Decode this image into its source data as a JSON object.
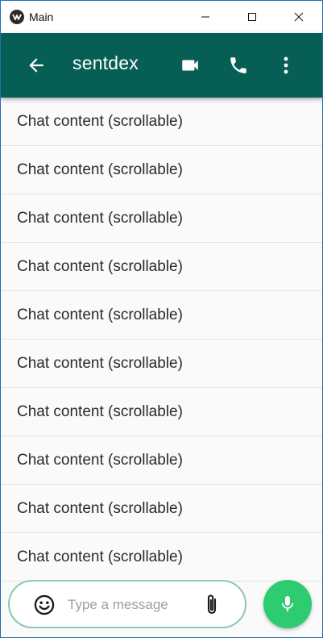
{
  "window": {
    "title": "Main",
    "controls": [
      "minimize",
      "maximize",
      "close"
    ]
  },
  "header": {
    "contact_name": "sentdex",
    "icons": [
      "back-arrow-icon",
      "videocam-icon",
      "phone-icon",
      "more-vert-icon"
    ],
    "background": "#075e54"
  },
  "chat": {
    "items": [
      {
        "text": "Chat content (scrollable)"
      },
      {
        "text": "Chat content (scrollable)"
      },
      {
        "text": "Chat content (scrollable)"
      },
      {
        "text": "Chat content (scrollable)"
      },
      {
        "text": "Chat content (scrollable)"
      },
      {
        "text": "Chat content (scrollable)"
      },
      {
        "text": "Chat content (scrollable)"
      },
      {
        "text": "Chat content (scrollable)"
      },
      {
        "text": "Chat content (scrollable)"
      },
      {
        "text": "Chat content (scrollable)"
      }
    ]
  },
  "composer": {
    "placeholder": "Type a message",
    "value": "",
    "icons": [
      "emoji-icon",
      "attach-icon",
      "mic-icon"
    ],
    "mic_color": "#2ecc71"
  }
}
